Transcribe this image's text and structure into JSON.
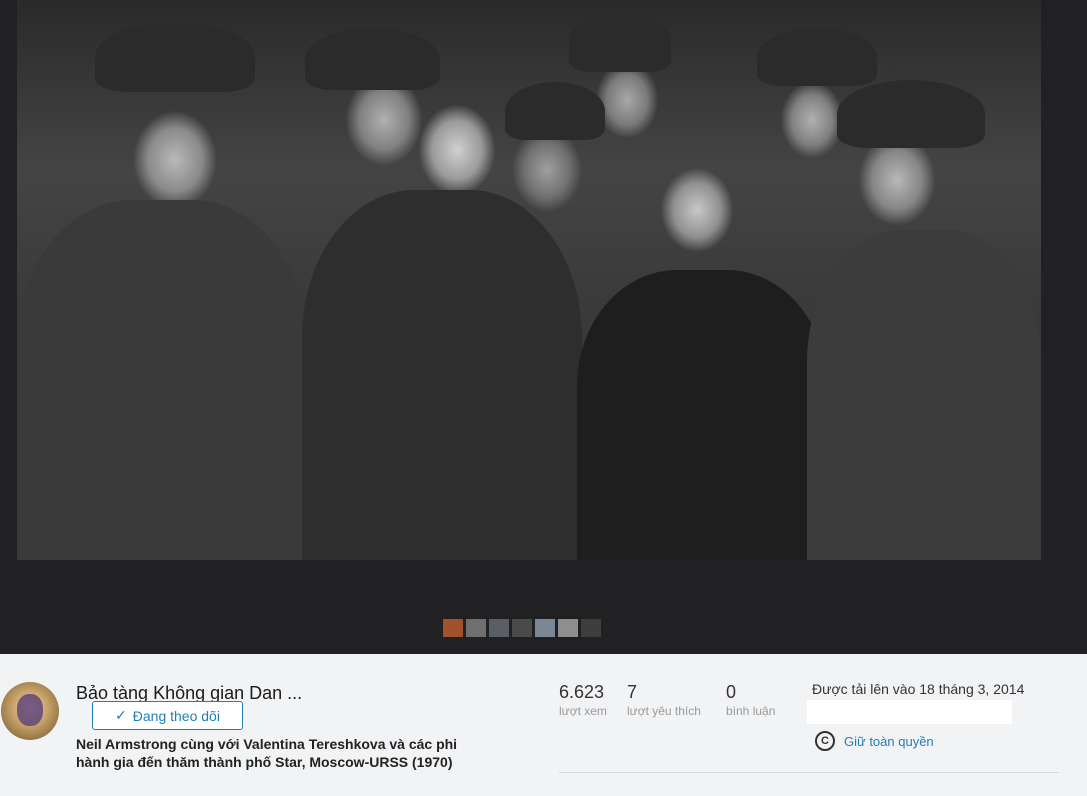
{
  "photo": {
    "alt": "Neil Armstrong cùng với Valentina Tereshkova và các phi hành gia đến thăm thành phố Star, Moscow-URSS (1970)"
  },
  "thumbnails": [
    {
      "color": "#a0522d"
    },
    {
      "color": "#6f6f6f"
    },
    {
      "color": "#5a5f66"
    },
    {
      "color": "#4a4a4a"
    },
    {
      "color": "#7c8796"
    },
    {
      "color": "#8e8e8e"
    },
    {
      "color": "#3e3e3e"
    }
  ],
  "author": {
    "name": "Bảo tàng Không gian Dan ...",
    "follow_label": "Đang theo dõi"
  },
  "photo_title": "Neil Armstrong cùng với Valentina Tereshkova và các phi hành gia đến thăm thành phố Star, Moscow-URSS (1970)",
  "stats": {
    "views": {
      "value": "6.623",
      "label": "lượt xem"
    },
    "faves": {
      "value": "7",
      "label": "lượt yêu thích"
    },
    "comments": {
      "value": "0",
      "label": "bình luận"
    }
  },
  "upload": {
    "text": "Được tải lên vào 18 tháng 3, 2014"
  },
  "license": {
    "icon": "cc-icon",
    "symbol": "C",
    "label": "Giữ toàn quyền"
  },
  "colors": {
    "accent": "#1f7fb6",
    "viewer_bg": "#212124",
    "info_bg": "#f2f3f5"
  }
}
